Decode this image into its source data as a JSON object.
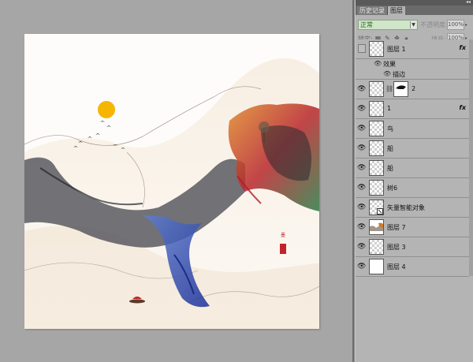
{
  "panel": {
    "tabs": [
      {
        "label": "历史记录",
        "active": false
      },
      {
        "label": "图层",
        "active": true
      }
    ],
    "blend_mode": "正常",
    "opacity_label": "不透明度:",
    "opacity_value": "100%",
    "lock_label": "锁定:",
    "fill_label": "填充:",
    "fill_value": "100%",
    "layers": [
      {
        "name": "图层 1",
        "visible": false,
        "fx": true,
        "thumb": "transparent"
      },
      {
        "name": "效果",
        "sub": true
      },
      {
        "name": "描边",
        "sub": true
      },
      {
        "name": "2",
        "visible": true,
        "mask": true,
        "thumb": "transparent"
      },
      {
        "name": "1",
        "visible": true,
        "fx": true,
        "thumb": "transparent"
      },
      {
        "name": "鸟",
        "visible": true,
        "thumb": "transparent"
      },
      {
        "name": "船",
        "visible": true,
        "thumb": "transparent"
      },
      {
        "name": "船",
        "visible": true,
        "thumb": "transparent"
      },
      {
        "name": "树6",
        "visible": true,
        "thumb": "transparent"
      },
      {
        "name": "矢量智能对象",
        "visible": true,
        "thumb": "smart"
      },
      {
        "name": "图层 7",
        "visible": true,
        "thumb": "painting"
      },
      {
        "name": "图层 3",
        "visible": true,
        "thumb": "transparent"
      },
      {
        "name": "图层 4",
        "visible": true,
        "thumb": "white"
      }
    ],
    "fx_glyph": "fx"
  },
  "colors": {
    "sun": "#f5b500",
    "ink_blue": "#1e3aa8",
    "ink_dark": "#3c3c46",
    "autumn_orange": "#c96a1a",
    "red": "#c01c2c",
    "green": "#1d8a4a",
    "seal_red": "#c0242a"
  }
}
